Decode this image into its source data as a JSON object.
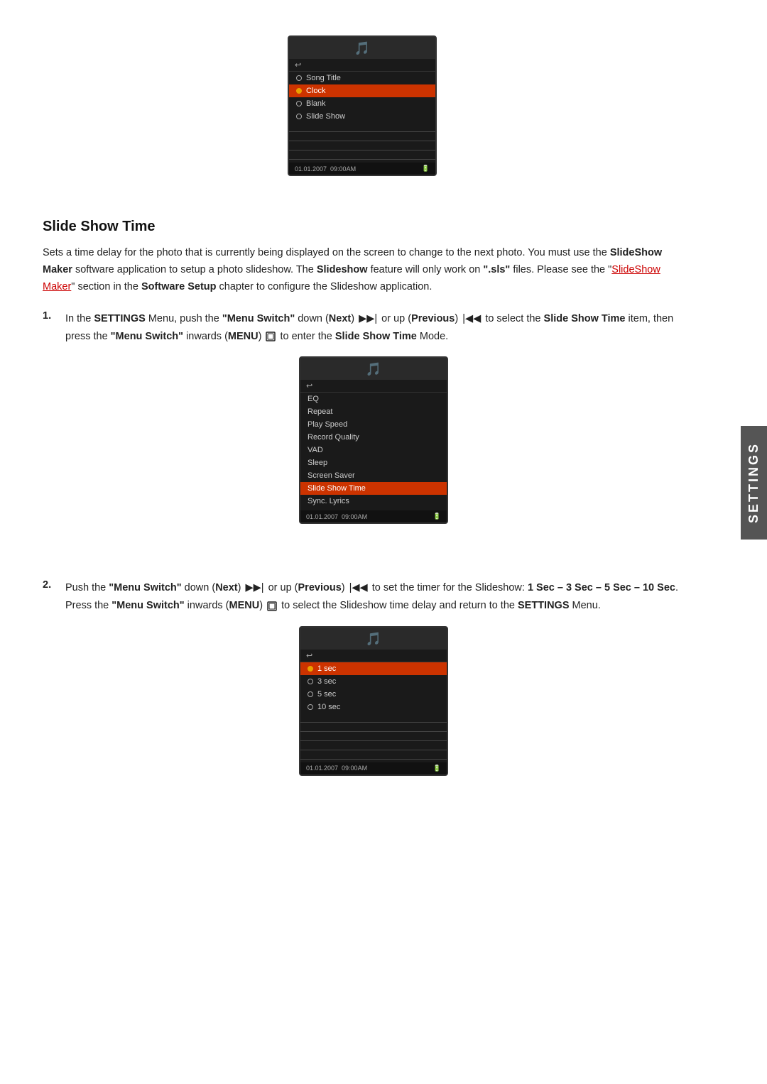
{
  "settings_tab": {
    "label": "SETTINGS"
  },
  "screen1": {
    "logo": "🎵",
    "back_label": "↩",
    "menu_items": [
      {
        "label": "Song Title",
        "type": "radio",
        "checked": false,
        "selected": false
      },
      {
        "label": "Clock",
        "type": "radio",
        "checked": true,
        "selected": true
      },
      {
        "label": "Blank",
        "type": "radio",
        "checked": false,
        "selected": false
      },
      {
        "label": "Slide Show",
        "type": "radio",
        "checked": false,
        "selected": false
      }
    ],
    "footer": "01.01.2007  09:00AM  🔋"
  },
  "section": {
    "title": "Slide Show Time",
    "body_parts": [
      "Sets a time delay for the photo that is currently being displayed on the screen to change to the next photo. You must use the ",
      "SlideShow Maker",
      " software application to setup a photo slideshow. The ",
      "Slideshow",
      " feature will only work on ",
      "\".sls\"",
      " files. Please see the \"",
      "SlideShow Maker",
      "\" section in the ",
      "Software Setup",
      " chapter to configure the Slideshow application."
    ]
  },
  "step1": {
    "number": "1.",
    "text_parts": [
      "In the ",
      "SETTINGS",
      " Menu, push the ",
      "\"Menu Switch\"",
      " down (",
      "Next",
      ") ",
      "▶▶|",
      " or up (",
      "Previous",
      ") ",
      "|◀◀",
      " to select the ",
      "Slide Show Time",
      " item, then press the ",
      "\"Menu Switch\"",
      " inwards (",
      "MENU",
      ") ",
      "⊡",
      " to enter the ",
      "Slide Show Time",
      " Mode."
    ]
  },
  "screen2": {
    "logo": "🎵",
    "back_label": "↩",
    "menu_items": [
      {
        "label": "EQ",
        "selected": false
      },
      {
        "label": "Repeat",
        "selected": false
      },
      {
        "label": "Play Speed",
        "selected": false
      },
      {
        "label": "Record Quality",
        "selected": false
      },
      {
        "label": "VAD",
        "selected": false
      },
      {
        "label": "Sleep",
        "selected": false
      },
      {
        "label": "Screen Saver",
        "selected": false
      },
      {
        "label": "Slide Show Time",
        "selected": true
      },
      {
        "label": "Sync. Lyrics",
        "selected": false
      }
    ],
    "footer": "01.01.2007  09:00AM  🔋"
  },
  "step2": {
    "number": "2.",
    "text_parts": [
      "Push the ",
      "\"Menu Switch\"",
      " down (",
      "Next",
      ") ",
      "▶▶|",
      " or up (",
      "Previous",
      ") ",
      "|◀◀",
      " to set the timer for the Slideshow: ",
      "1 Sec – 3 Sec – 5 Sec – 10 Sec",
      ". Press the ",
      "\"Menu Switch\"",
      " inwards (",
      "MENU",
      ") ",
      "⊡",
      " to select the Slideshow time delay and return to the ",
      "SETTINGS",
      " Menu."
    ]
  },
  "screen3": {
    "logo": "🎵",
    "back_label": "↩",
    "menu_items": [
      {
        "label": "1 sec",
        "type": "radio",
        "checked": true,
        "selected": true
      },
      {
        "label": "3 sec",
        "type": "radio",
        "checked": false,
        "selected": false
      },
      {
        "label": "5 sec",
        "type": "radio",
        "checked": false,
        "selected": false
      },
      {
        "label": "10 sec",
        "type": "radio",
        "checked": false,
        "selected": false
      }
    ],
    "footer": "01.01.2007  09:00AM  🔋"
  }
}
